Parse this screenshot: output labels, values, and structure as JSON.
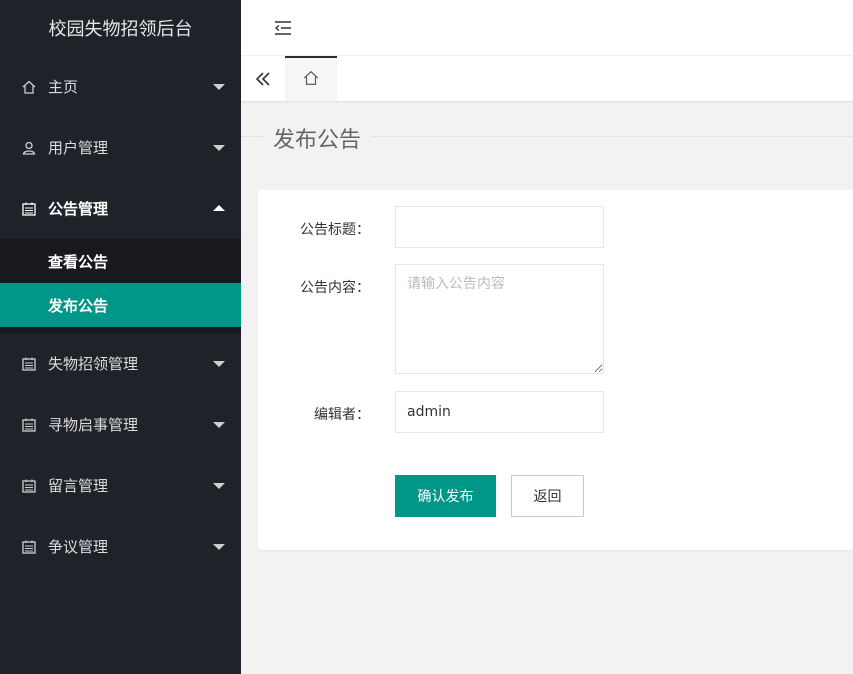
{
  "sidebar": {
    "logo": "校园失物招领后台",
    "items": [
      {
        "label": "主页",
        "icon": "home-icon"
      },
      {
        "label": "用户管理",
        "icon": "user-icon"
      },
      {
        "label": "公告管理",
        "icon": "calendar-icon",
        "open": true,
        "children": [
          {
            "label": "查看公告"
          },
          {
            "label": "发布公告",
            "active": true
          }
        ]
      },
      {
        "label": "失物招领管理",
        "icon": "calendar-icon"
      },
      {
        "label": "寻物启事管理",
        "icon": "calendar-icon"
      },
      {
        "label": "留言管理",
        "icon": "calendar-icon"
      },
      {
        "label": "争议管理",
        "icon": "calendar-icon"
      }
    ]
  },
  "header": {
    "menu_toggle_icon": "menu-fold-icon"
  },
  "tabs": {
    "prev_icon": "double-chevron-left-icon",
    "home_icon": "home-icon"
  },
  "page": {
    "title": "发布公告"
  },
  "form": {
    "title_label": "公告标题：",
    "title_value": "",
    "content_label": "公告内容：",
    "content_placeholder": "请输入公告内容",
    "editor_label": "编辑者：",
    "editor_value": "admin",
    "submit_label": "确认发布",
    "back_label": "返回"
  },
  "colors": {
    "sidebar_bg": "#20222a",
    "accent": "#009688"
  }
}
